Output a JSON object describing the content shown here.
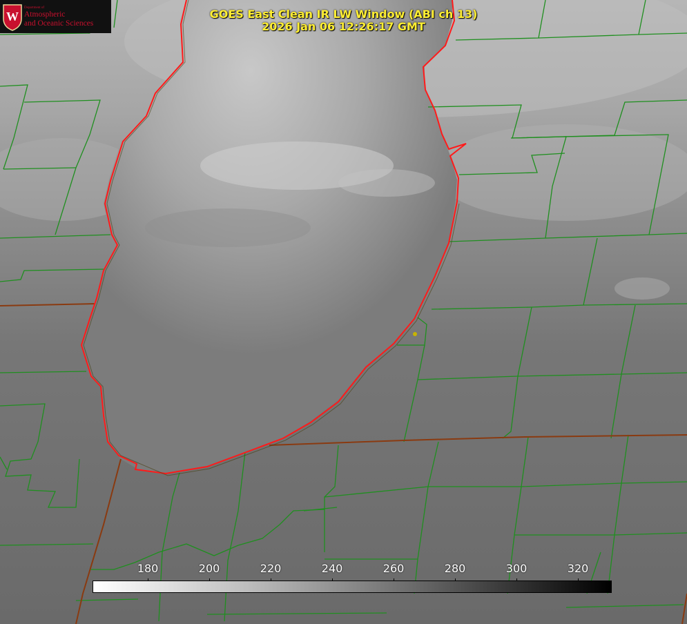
{
  "title": {
    "line1": "GOES East Clean IR LW Window (ABI ch 13)",
    "line2": "2026 Jan 06 12:26:17 GMT"
  },
  "logo": {
    "department": "Department of",
    "line1": "Atmospheric",
    "line2": "and Oceanic Sciences",
    "seal_letter": "W",
    "colors": {
      "seal": "#c8102e",
      "text": "#c8102e",
      "background": "#111111"
    }
  },
  "colorbar": {
    "ticks": [
      "180",
      "200",
      "220",
      "240",
      "260",
      "280",
      "300",
      "320"
    ],
    "tick_values": [
      180,
      200,
      220,
      240,
      260,
      280,
      300,
      320
    ],
    "range": [
      162,
      331
    ],
    "colors": {
      "low": "#ffffff",
      "high": "#000000"
    }
  },
  "map": {
    "colors": {
      "county_lines": "#1f8f1f",
      "state_lines": "#8a3a10",
      "coastline": "#ff1a1a",
      "station": "#c8b400"
    }
  }
}
